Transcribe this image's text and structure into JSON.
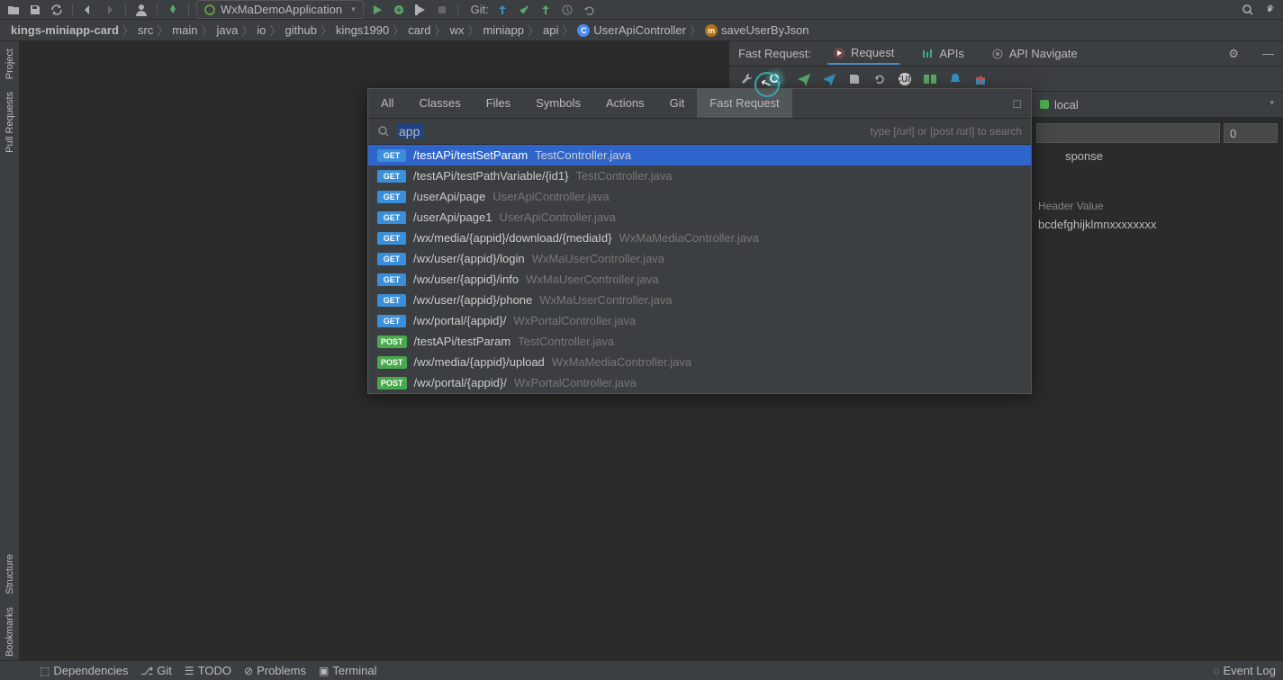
{
  "toolbar": {
    "run_config": "WxMaDemoApplication",
    "git_label": "Git:"
  },
  "breadcrumb": [
    "kings-miniapp-card",
    "src",
    "main",
    "java",
    "io",
    "github",
    "kings1990",
    "card",
    "wx",
    "miniapp",
    "api"
  ],
  "breadcrumb_class": "UserApiController",
  "breadcrumb_method": "saveUserByJson",
  "left_gutter": [
    "Project",
    "Pull Requests",
    "Bookmarks",
    "Structure"
  ],
  "fast_request": {
    "label": "Fast Request:",
    "tabs": [
      {
        "label": "Request",
        "active": true
      },
      {
        "label": "APIs",
        "active": false
      },
      {
        "label": "API Navigate",
        "active": false
      }
    ],
    "env": "local",
    "num_field": "0",
    "response_label": "sponse",
    "header_value_label": "Header Value",
    "header_value": "bcdefghijklmnxxxxxxxx"
  },
  "search_everywhere": {
    "tabs": [
      "All",
      "Classes",
      "Files",
      "Symbols",
      "Actions",
      "Git",
      "Fast Request"
    ],
    "active_tab": "Fast Request",
    "query": "app",
    "hint": "type [/url] or [post /url] to search",
    "results": [
      {
        "method": "GET",
        "path": "/testAPi/testSetParam",
        "file": "TestController.java",
        "selected": true
      },
      {
        "method": "GET",
        "path": "/testAPi/testPathVariable/{id1}",
        "file": "TestController.java"
      },
      {
        "method": "GET",
        "path": "/userApi/page",
        "file": "UserApiController.java"
      },
      {
        "method": "GET",
        "path": "/userApi/page1",
        "file": "UserApiController.java"
      },
      {
        "method": "GET",
        "path": "/wx/media/{appid}/download/{mediaId}",
        "file": "WxMaMediaController.java"
      },
      {
        "method": "GET",
        "path": "/wx/user/{appid}/login",
        "file": "WxMaUserController.java"
      },
      {
        "method": "GET",
        "path": "/wx/user/{appid}/info",
        "file": "WxMaUserController.java"
      },
      {
        "method": "GET",
        "path": "/wx/user/{appid}/phone",
        "file": "WxMaUserController.java"
      },
      {
        "method": "GET",
        "path": "/wx/portal/{appid}/",
        "file": "WxPortalController.java"
      },
      {
        "method": "POST",
        "path": "/testAPi/testParam",
        "file": "TestController.java"
      },
      {
        "method": "POST",
        "path": "/wx/media/{appid}/upload",
        "file": "WxMaMediaController.java"
      },
      {
        "method": "POST",
        "path": "/wx/portal/{appid}/",
        "file": "WxPortalController.java"
      }
    ]
  },
  "status_bar": {
    "items": [
      "Dependencies",
      "Git",
      "TODO",
      "Problems",
      "Terminal"
    ],
    "event_log": "Event Log"
  }
}
